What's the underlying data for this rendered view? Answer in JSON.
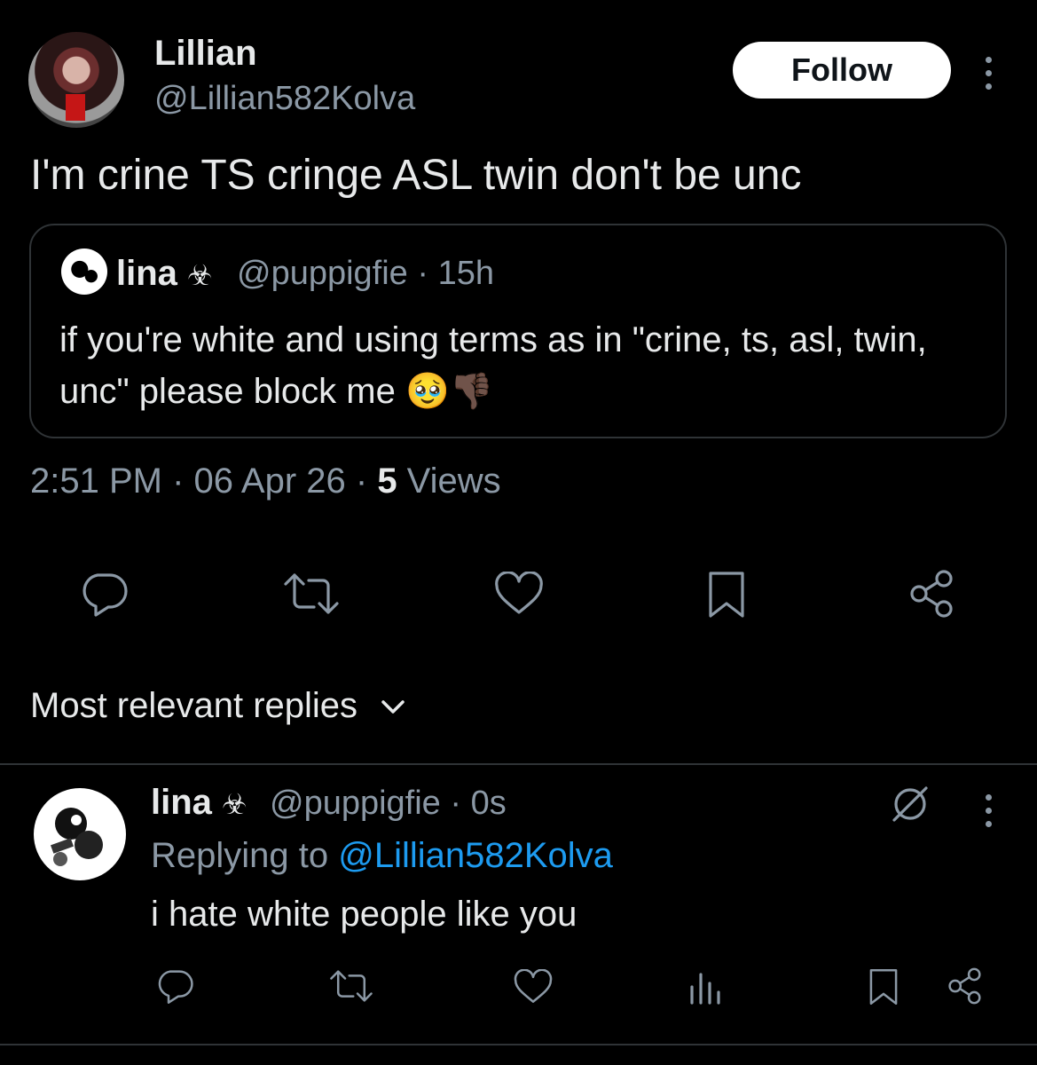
{
  "tweet": {
    "author_name": "Lillian",
    "author_handle": "@Lillian582Kolva",
    "follow_label": "Follow",
    "text": "I'm crine TS cringe ASL twin don't be unc",
    "timestamp": "2:51 PM · 06 Apr 26 · ",
    "views_count": "5",
    "views_label": " Views"
  },
  "quote": {
    "name": "lina",
    "name_emoji": "☣",
    "handle_time": "@puppigfie · 15h",
    "text": "if you're white and using terms as in \"crine,  ts, asl, twin, unc\" please block me 🥹👎🏿"
  },
  "actions": [
    "reply-icon",
    "retweet-icon",
    "like-icon",
    "bookmark-icon",
    "share-icon"
  ],
  "replies_sort": {
    "label": "Most relevant replies"
  },
  "reply": {
    "name": "lina",
    "name_emoji": "☣",
    "handle_time": "@puppigfie · 0s",
    "replying_prefix": "Replying to ",
    "replying_to": "@Lillian582Kolva",
    "text": "i hate white people like you",
    "actions": [
      "reply-icon",
      "retweet-icon",
      "like-icon",
      "analytics-icon",
      "bookmark-icon",
      "share-icon"
    ]
  },
  "colors": {
    "background": "#000000",
    "text": "#e7e9ea",
    "muted": "#8b98a5",
    "link": "#1d9bf0",
    "border": "#2f3336"
  }
}
